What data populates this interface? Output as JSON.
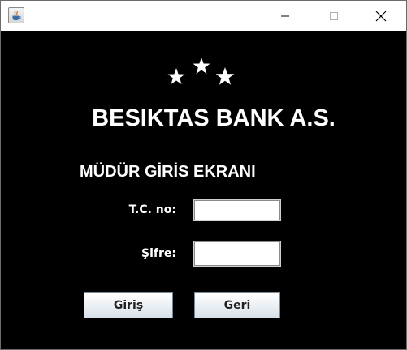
{
  "window": {
    "minimize_label": "Minimize",
    "maximize_label": "Maximize",
    "close_label": "Close"
  },
  "header": {
    "bank_name": "BESIKTAS BANK A.S.",
    "screen_title": "MÜDÜR GİRİS EKRANI",
    "logo_icon": "three-stars-icon"
  },
  "form": {
    "tc_label": "T.C. no:",
    "tc_value": "",
    "password_label": "Şifre:",
    "password_value": ""
  },
  "buttons": {
    "login_label": "Giriş",
    "back_label": "Geri"
  },
  "colors": {
    "background": "#000000",
    "text": "#ffffff"
  }
}
